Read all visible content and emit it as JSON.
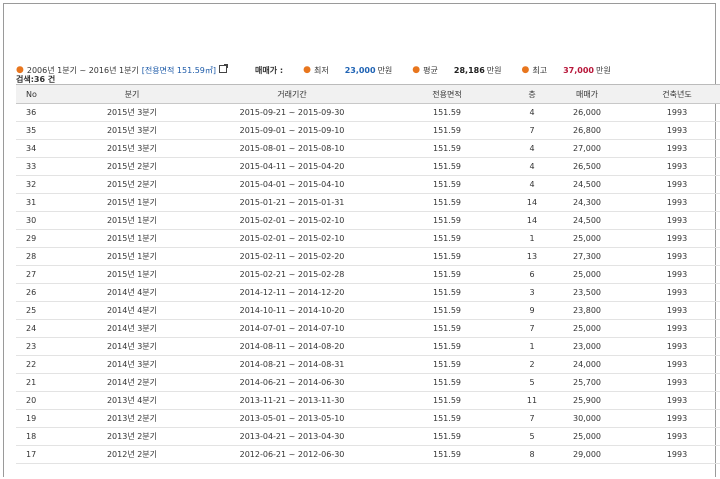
{
  "summary": {
    "period": "2006년 1분기 ~ 2016년 1분기",
    "area": "[전용면적 151.59㎡]",
    "price_label": "매매가 :",
    "min_label": "최저",
    "min_value": "23,000",
    "avg_label": "평균",
    "avg_value": "28,186",
    "max_label": "최고",
    "max_value": "37,000",
    "unit": "만원",
    "count": "검색:36 건"
  },
  "table": {
    "headers": [
      "No",
      "분기",
      "거래기간",
      "전용면적",
      "층",
      "매매가",
      "건축년도"
    ],
    "rows": [
      [
        "36",
        "2015년 3분기",
        "2015-09-21 ~ 2015-09-30",
        "151.59",
        "4",
        "26,000",
        "1993"
      ],
      [
        "35",
        "2015년 3분기",
        "2015-09-01 ~ 2015-09-10",
        "151.59",
        "7",
        "26,800",
        "1993"
      ],
      [
        "34",
        "2015년 3분기",
        "2015-08-01 ~ 2015-08-10",
        "151.59",
        "4",
        "27,000",
        "1993"
      ],
      [
        "33",
        "2015년 2분기",
        "2015-04-11 ~ 2015-04-20",
        "151.59",
        "4",
        "26,500",
        "1993"
      ],
      [
        "32",
        "2015년 2분기",
        "2015-04-01 ~ 2015-04-10",
        "151.59",
        "4",
        "24,500",
        "1993"
      ],
      [
        "31",
        "2015년 1분기",
        "2015-01-21 ~ 2015-01-31",
        "151.59",
        "14",
        "24,300",
        "1993"
      ],
      [
        "30",
        "2015년 1분기",
        "2015-02-01 ~ 2015-02-10",
        "151.59",
        "14",
        "24,500",
        "1993"
      ],
      [
        "29",
        "2015년 1분기",
        "2015-02-01 ~ 2015-02-10",
        "151.59",
        "1",
        "25,000",
        "1993"
      ],
      [
        "28",
        "2015년 1분기",
        "2015-02-11 ~ 2015-02-20",
        "151.59",
        "13",
        "27,300",
        "1993"
      ],
      [
        "27",
        "2015년 1분기",
        "2015-02-21 ~ 2015-02-28",
        "151.59",
        "6",
        "25,000",
        "1993"
      ],
      [
        "26",
        "2014년 4분기",
        "2014-12-11 ~ 2014-12-20",
        "151.59",
        "3",
        "23,500",
        "1993"
      ],
      [
        "25",
        "2014년 4분기",
        "2014-10-11 ~ 2014-10-20",
        "151.59",
        "9",
        "23,800",
        "1993"
      ],
      [
        "24",
        "2014년 3분기",
        "2014-07-01 ~ 2014-07-10",
        "151.59",
        "7",
        "25,000",
        "1993"
      ],
      [
        "23",
        "2014년 3분기",
        "2014-08-11 ~ 2014-08-20",
        "151.59",
        "1",
        "23,000",
        "1993"
      ],
      [
        "22",
        "2014년 3분기",
        "2014-08-21 ~ 2014-08-31",
        "151.59",
        "2",
        "24,000",
        "1993"
      ],
      [
        "21",
        "2014년 2분기",
        "2014-06-21 ~ 2014-06-30",
        "151.59",
        "5",
        "25,700",
        "1993"
      ],
      [
        "20",
        "2013년 4분기",
        "2013-11-21 ~ 2013-11-30",
        "151.59",
        "11",
        "25,900",
        "1993"
      ],
      [
        "19",
        "2013년 2분기",
        "2013-05-01 ~ 2013-05-10",
        "151.59",
        "7",
        "30,000",
        "1993"
      ],
      [
        "18",
        "2013년 2분기",
        "2013-04-21 ~ 2013-04-30",
        "151.59",
        "5",
        "25,000",
        "1993"
      ],
      [
        "17",
        "2012년 2분기",
        "2012-06-21 ~ 2012-06-30",
        "151.59",
        "8",
        "29,000",
        "1993"
      ]
    ]
  }
}
